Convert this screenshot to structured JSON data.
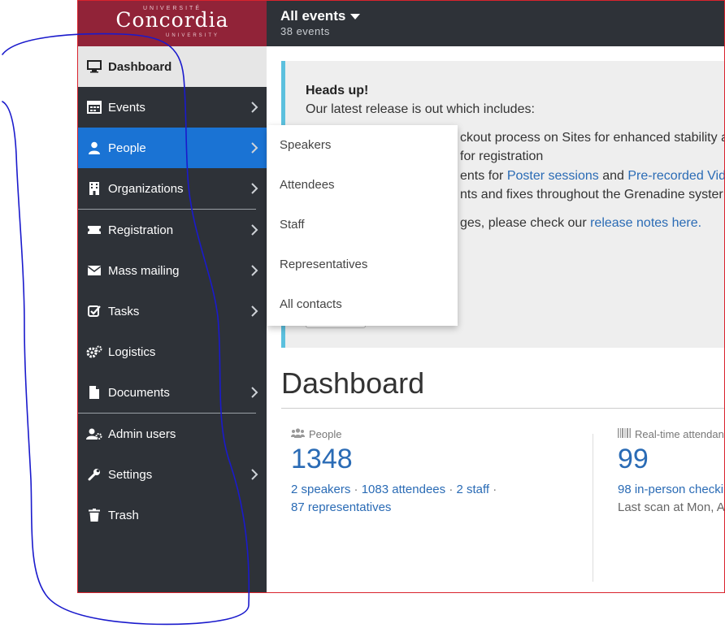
{
  "logo": {
    "top": "UNIVERSITÉ",
    "main": "Concordia",
    "bottom": "UNIVERSITY"
  },
  "topbar": {
    "title": "All events",
    "subtitle": "38 events"
  },
  "sidebar": {
    "items": [
      {
        "label": "Dashboard",
        "icon": "monitor-icon"
      },
      {
        "label": "Events",
        "icon": "calendar-icon"
      },
      {
        "label": "People",
        "icon": "person-icon"
      },
      {
        "label": "Organizations",
        "icon": "building-icon"
      },
      {
        "label": "Registration",
        "icon": "ticket-icon"
      },
      {
        "label": "Mass mailing",
        "icon": "envelope-icon"
      },
      {
        "label": "Tasks",
        "icon": "checkbox-icon"
      },
      {
        "label": "Logistics",
        "icon": "gears-icon"
      },
      {
        "label": "Documents",
        "icon": "file-icon"
      },
      {
        "label": "Admin users",
        "icon": "users-cog-icon"
      },
      {
        "label": "Settings",
        "icon": "wrench-icon"
      },
      {
        "label": "Trash",
        "icon": "trash-icon"
      }
    ]
  },
  "people_menu": {
    "items": [
      "Speakers",
      "Attendees",
      "Staff",
      "Representatives",
      "All contacts"
    ]
  },
  "alert": {
    "heading": "Heads up!",
    "intro": "Our latest release is out which includes:",
    "line1": "ckout process on Sites for enhanced stability a",
    "line2": "for registration",
    "line3_pre": "ents for ",
    "line3_link1": "Poster sessions",
    "line3_mid": " and ",
    "line3_link2": "Pre-recorded Vid",
    "line4": "nts and fixes throughout the Grenadine syster",
    "line5_pre": "ges, please check our ",
    "line5_link": "release notes here."
  },
  "dashboard": {
    "title": "Dashboard",
    "people": {
      "label": "People",
      "count": "1348",
      "links": [
        "2 speakers",
        "1083 attendees",
        "2 staff",
        "87 representatives"
      ],
      "separator": " · "
    },
    "attendance": {
      "label": "Real-time attendan",
      "count": "99",
      "line1": "98 in-person checkir",
      "line2": "Last scan at Mon, A"
    }
  },
  "colors": {
    "brand": "#912338",
    "sidebar": "#2e3238",
    "selected": "#1a73d4",
    "link": "#2a6bb5",
    "alert_border": "#5bc0de",
    "annotation": "#1a1acc"
  }
}
